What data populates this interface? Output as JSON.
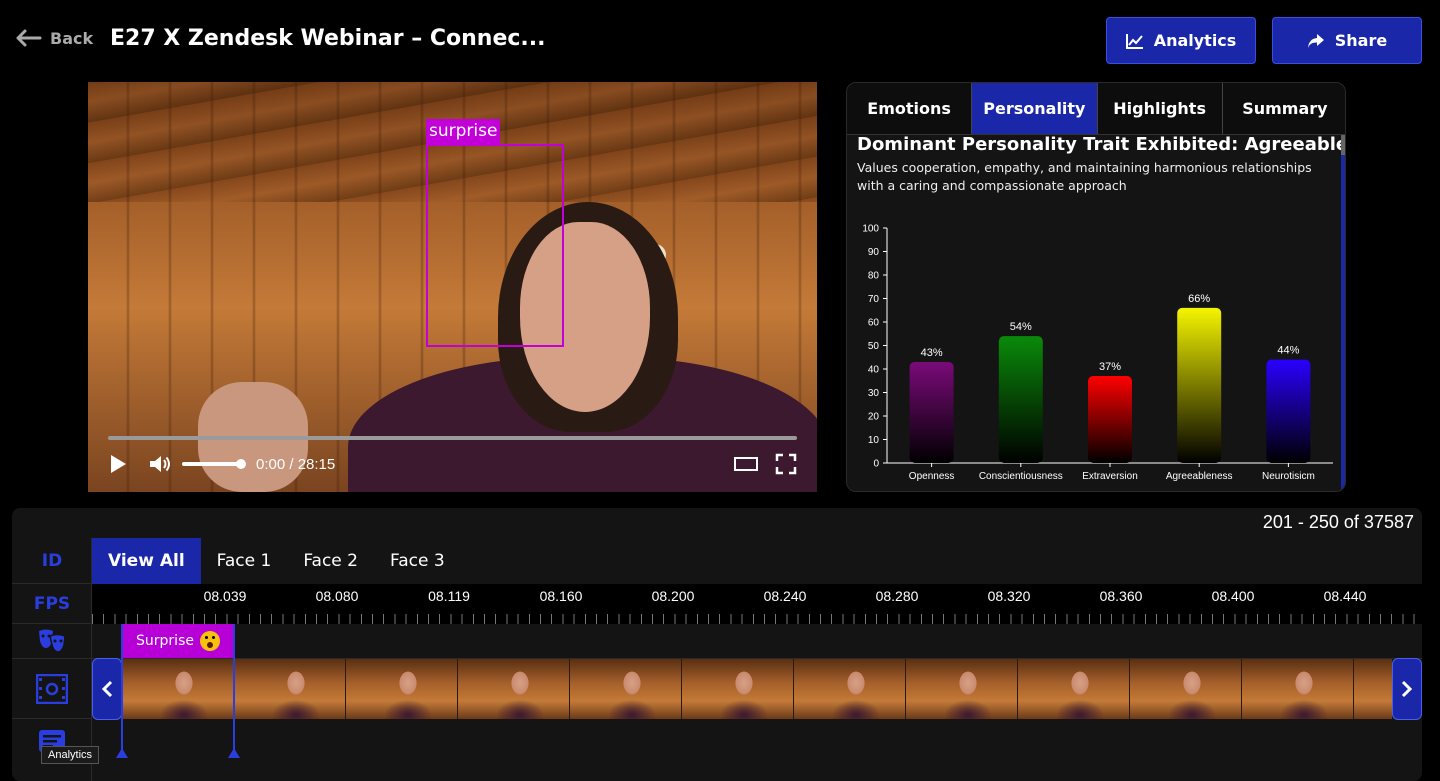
{
  "header": {
    "back_label": "Back",
    "title": "E27 X Zendesk Webinar – Connec...",
    "analytics_label": "Analytics",
    "share_label": "Share"
  },
  "video": {
    "emotion_label": "surprise",
    "time": "0:00 / 28:15",
    "progress": 0.0,
    "volume": 1.0
  },
  "panel": {
    "tabs": [
      {
        "label": "Emotions",
        "active": false
      },
      {
        "label": "Personality",
        "active": true
      },
      {
        "label": "Highlights",
        "active": false
      },
      {
        "label": "Summary",
        "active": false
      }
    ],
    "title": "Dominant Personality Trait Exhibited: Agreeableness",
    "description": "Values cooperation, empathy, and maintaining harmonious relationships with a caring and compassionate approach"
  },
  "chart_data": {
    "type": "bar",
    "categories": [
      "Openness",
      "Conscientiousness",
      "Extraversion",
      "Agreeableness",
      "Neurotisicm"
    ],
    "values": [
      43,
      54,
      37,
      66,
      44
    ],
    "data_labels": [
      "43%",
      "54%",
      "37%",
      "66%",
      "44%"
    ],
    "colors": [
      "#7a0a7a",
      "#0a8a0a",
      "#ff0000",
      "#f5f500",
      "#2a00ff"
    ],
    "yticks": [
      "0",
      "10",
      "20",
      "30",
      "40",
      "50",
      "60",
      "70",
      "80",
      "90",
      "100"
    ],
    "ylim": [
      0,
      100
    ],
    "title": "",
    "xlabel": "",
    "ylabel": ""
  },
  "timeline": {
    "count": "201 - 250 of 37587",
    "side": {
      "id_label": "ID",
      "fps_label": "FPS"
    },
    "face_tabs": [
      {
        "label": "View All",
        "active": true
      },
      {
        "label": "Face 1",
        "active": false
      },
      {
        "label": "Face 2",
        "active": false
      },
      {
        "label": "Face 3",
        "active": false
      }
    ],
    "ticks": [
      "08.039",
      "08.080",
      "08.119",
      "08.160",
      "08.200",
      "08.240",
      "08.280",
      "08.320",
      "08.360",
      "08.400",
      "08.440"
    ],
    "tag_label": "Surprise",
    "tooltip": "Analytics"
  },
  "colors": {
    "accent": "#1a27a8",
    "emotion": "#c200d8",
    "background": "#000000",
    "panel": "#141414"
  }
}
